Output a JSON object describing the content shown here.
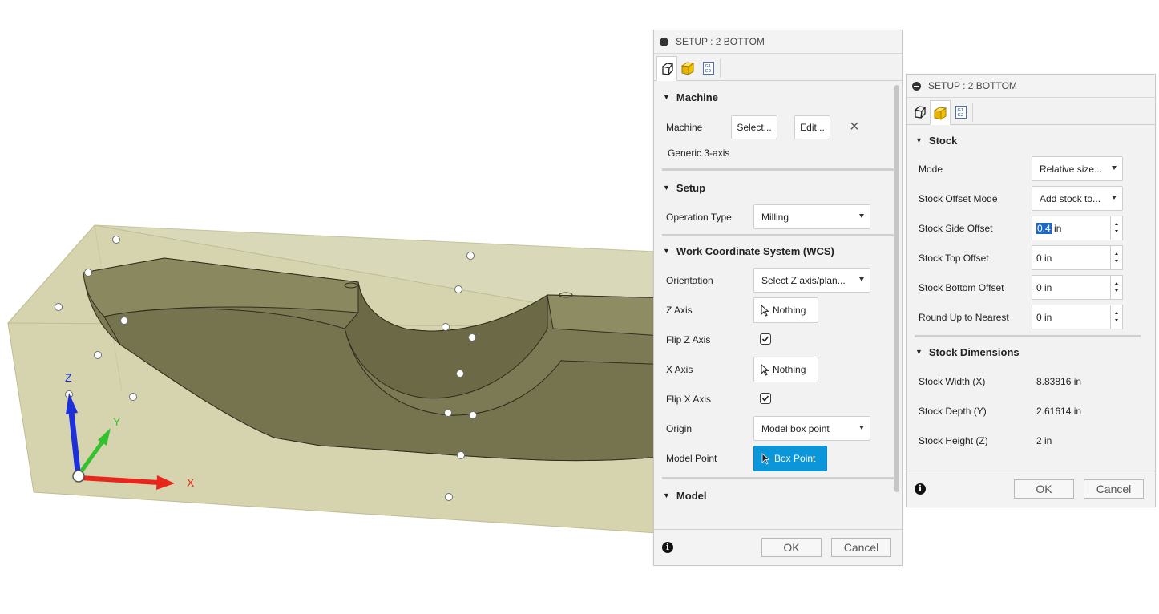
{
  "viewport": {
    "axis_labels": {
      "x": "X",
      "y": "Y",
      "z": "Z"
    },
    "colors": {
      "x_axis": "#e8261c",
      "y_axis": "#35c12e",
      "z_axis": "#1d2fd6",
      "stock_box": "#d8d8b4",
      "part": "#76744f"
    }
  },
  "setup_panel": {
    "title": "SETUP : 2 BOTTOM",
    "tabs": [
      "setup-tab-icon",
      "stock-tab-icon",
      "post-process-tab-icon"
    ],
    "active_tab": 0,
    "machine_section": {
      "header": "Machine",
      "machine_label": "Machine",
      "select_button": "Select...",
      "edit_button": "Edit...",
      "clear_symbol": "×",
      "machine_name": "Generic 3-axis"
    },
    "setup_section": {
      "header": "Setup",
      "operation_type_label": "Operation Type",
      "operation_type_value": "Milling"
    },
    "wcs_section": {
      "header": "Work Coordinate System (WCS)",
      "orientation_label": "Orientation",
      "orientation_value": "Select Z axis/plan...",
      "z_axis_label": "Z Axis",
      "z_axis_value": "Nothing",
      "flip_z_label": "Flip Z Axis",
      "flip_z_checked": true,
      "x_axis_label": "X Axis",
      "x_axis_value": "Nothing",
      "flip_x_label": "Flip X Axis",
      "flip_x_checked": true,
      "origin_label": "Origin",
      "origin_value": "Model box point",
      "model_point_label": "Model Point",
      "model_point_value": "Box Point"
    },
    "model_section": {
      "header": "Model"
    },
    "footer": {
      "info": "i",
      "ok": "OK",
      "cancel": "Cancel"
    }
  },
  "stock_panel": {
    "title": "SETUP : 2 BOTTOM",
    "tabs": [
      "setup-tab-icon",
      "stock-tab-icon",
      "post-process-tab-icon"
    ],
    "active_tab": 1,
    "stock_section": {
      "header": "Stock",
      "mode_label": "Mode",
      "mode_value": "Relative size...",
      "offset_mode_label": "Stock Offset Mode",
      "offset_mode_value": "Add stock to...",
      "side_offset_label": "Stock Side Offset",
      "side_offset_value_selected": "0.4",
      "side_offset_unit": " in",
      "top_offset_label": "Stock Top Offset",
      "top_offset_value": "0 in",
      "bottom_offset_label": "Stock Bottom Offset",
      "bottom_offset_value": "0 in",
      "round_up_label": "Round Up to Nearest",
      "round_up_value": "0 in"
    },
    "dimensions_section": {
      "header": "Stock Dimensions",
      "width_label": "Stock Width (X)",
      "width_value": "8.83816 in",
      "depth_label": "Stock Depth (Y)",
      "depth_value": "2.61614 in",
      "height_label": "Stock Height (Z)",
      "height_value": "2 in"
    },
    "footer": {
      "info": "i",
      "ok": "OK",
      "cancel": "Cancel"
    }
  }
}
